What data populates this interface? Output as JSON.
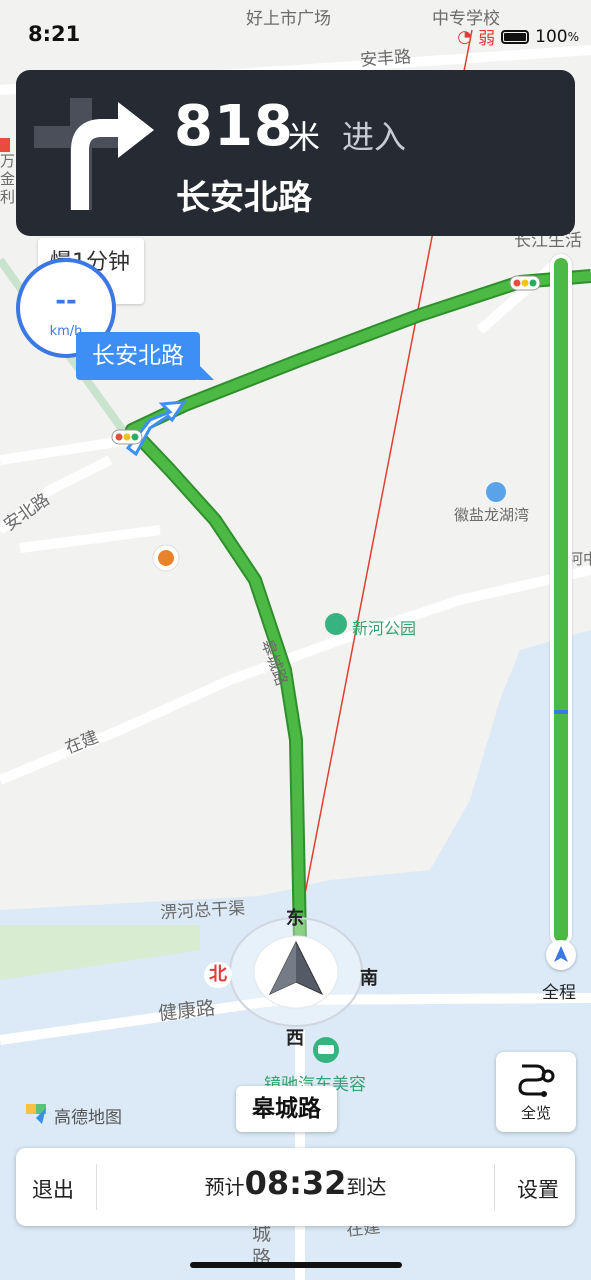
{
  "status_bar": {
    "time": "8:21",
    "signal": "弱",
    "battery": "100",
    "battery_unit": "%"
  },
  "nav": {
    "distance": "818",
    "distance_unit": "米",
    "action": "进入",
    "next_road": "长安北路"
  },
  "speed": {
    "value": "--",
    "unit": "km/h",
    "notice": "慢1分钟"
  },
  "route_tag": "长安北路",
  "map_labels": {
    "haoshang": "好上市广场",
    "anfeng": "安丰路",
    "zhuanye": "中专学校",
    "changjiang": "长江生活",
    "west_road": "安北路",
    "huiyan": "徽盐龙湖湾",
    "xinhe_park": "新河公园",
    "gaocheng_road_map": "皋城路",
    "zaijian": "在建",
    "pihe": "淠河总干渠",
    "jiankang": "健康路",
    "car_beauty": "镜驰汽车美容",
    "right_edge": "河中",
    "bottom_road": "城路",
    "bottom_zaijian": "在建",
    "left_edge": "万金利"
  },
  "compass": {
    "east": "东",
    "south": "南",
    "west": "西",
    "north": "北"
  },
  "current_road": "皋城路",
  "progress_label": "全程",
  "overview_label": "全览",
  "bottom": {
    "exit": "退出",
    "eta_prefix": "预计",
    "eta_time": "08:32",
    "eta_suffix": "到达",
    "settings": "设置"
  },
  "logo_text": "高德地图",
  "colors": {
    "route": "#4cb944",
    "accent": "#3a78e6",
    "card": "#262a33",
    "water": "#dbeaf6"
  }
}
